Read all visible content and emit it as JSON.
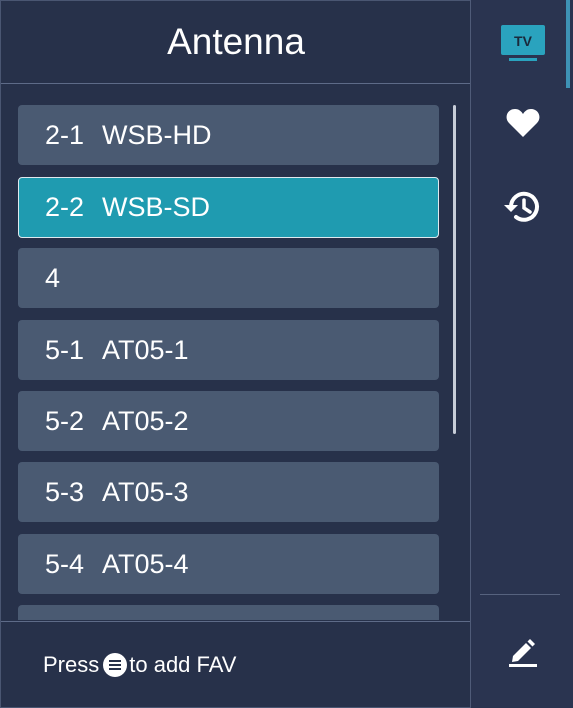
{
  "header": {
    "title": "Antenna"
  },
  "channels": [
    {
      "number": "2-1",
      "name": "WSB-HD",
      "selected": false
    },
    {
      "number": "2-2",
      "name": "WSB-SD",
      "selected": true
    },
    {
      "number": "4",
      "name": "",
      "selected": false
    },
    {
      "number": "5-1",
      "name": "AT05-1",
      "selected": false
    },
    {
      "number": "5-2",
      "name": "AT05-2",
      "selected": false
    },
    {
      "number": "5-3",
      "name": "AT05-3",
      "selected": false
    },
    {
      "number": "5-4",
      "name": "AT05-4",
      "selected": false
    }
  ],
  "footer": {
    "press_label": "Press",
    "action_label": "to add FAV"
  },
  "sidebar": {
    "tv_icon_label": "TV",
    "items": [
      {
        "icon": "tv-icon"
      },
      {
        "icon": "heart-icon"
      },
      {
        "icon": "history-icon"
      },
      {
        "icon": "edit-icon"
      }
    ]
  },
  "colors": {
    "background": "#27314a",
    "item": "#4a5a72",
    "selected": "#1f9bb0",
    "accent": "#2aa3be"
  }
}
